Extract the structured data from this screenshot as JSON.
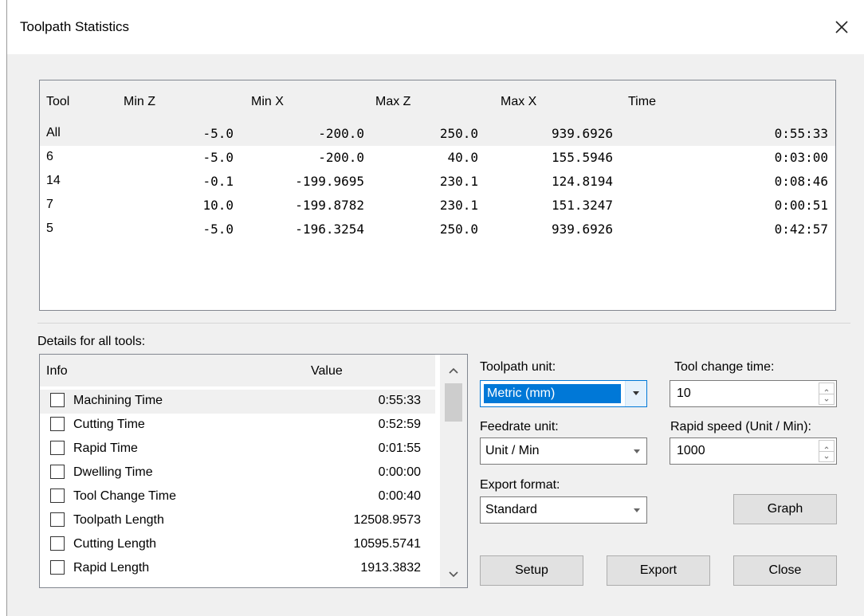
{
  "window": {
    "title": "Toolpath Statistics"
  },
  "tool_table": {
    "columns": [
      "Tool",
      "Min Z",
      "Min X",
      "Max Z",
      "Max X",
      "Time"
    ],
    "rows": [
      [
        "All",
        "-5.0",
        "-200.0",
        "250.0",
        "939.6926",
        "0:55:33"
      ],
      [
        "6",
        "-5.0",
        "-200.0",
        "40.0",
        "155.5946",
        "0:03:00"
      ],
      [
        "14",
        "-0.1",
        "-199.9695",
        "230.1",
        "124.8194",
        "0:08:46"
      ],
      [
        "7",
        "10.0",
        "-199.8782",
        "230.1",
        "151.3247",
        "0:00:51"
      ],
      [
        "5",
        "-5.0",
        "-196.3254",
        "250.0",
        "939.6926",
        "0:42:57"
      ]
    ]
  },
  "details": {
    "label": "Details for all tools:",
    "columns": [
      "Info",
      "Value"
    ],
    "rows": [
      {
        "label": "Machining Time",
        "value": "0:55:33",
        "checked": false
      },
      {
        "label": "Cutting Time",
        "value": "0:52:59",
        "checked": false
      },
      {
        "label": "Rapid Time",
        "value": "0:01:55",
        "checked": false
      },
      {
        "label": "Dwelling Time",
        "value": "0:00:00",
        "checked": false
      },
      {
        "label": "Tool Change Time",
        "value": "0:00:40",
        "checked": false
      },
      {
        "label": "Toolpath Length",
        "value": "12508.9573",
        "checked": false
      },
      {
        "label": "Cutting Length",
        "value": "10595.5741",
        "checked": false
      },
      {
        "label": "Rapid Length",
        "value": "1913.3832",
        "checked": false
      }
    ]
  },
  "settings": {
    "toolpath_unit": {
      "label": "Toolpath unit:",
      "value": "Metric (mm)"
    },
    "feedrate_unit": {
      "label": "Feedrate unit:",
      "value": "Unit / Min"
    },
    "export_format": {
      "label": "Export format:",
      "value": "Standard"
    },
    "tool_change_time": {
      "label": "Tool change time:",
      "value": "10"
    },
    "rapid_speed": {
      "label": "Rapid speed (Unit / Min):",
      "value": "1000"
    }
  },
  "buttons": {
    "graph": "Graph",
    "setup": "Setup",
    "export": "Export",
    "close": "Close"
  },
  "colors": {
    "selection": "#0078d7",
    "dialog_bg": "#f0f0f0",
    "border": "#828790"
  }
}
